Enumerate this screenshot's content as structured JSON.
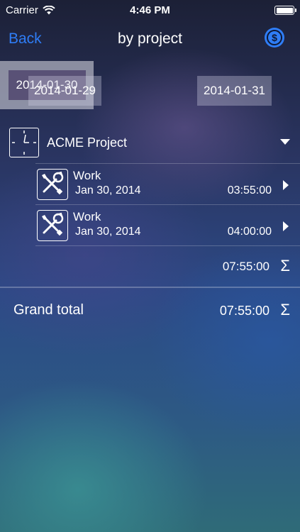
{
  "status_bar": {
    "carrier": "Carrier",
    "time": "4:46 PM",
    "battery_level": 1.0
  },
  "nav": {
    "back_label": "Back",
    "title": "by project",
    "action_icon": "dollar-circle-icon",
    "accent_color": "#2f7df6"
  },
  "dates": {
    "previous": "2014-01-29",
    "selected": "2014-01-30",
    "next": "2014-01-31"
  },
  "project": {
    "name": "ACME Project",
    "icon": "clock-icon",
    "entries": [
      {
        "title": "Work",
        "date": "Jan 30, 2014",
        "duration": "03:55:00",
        "icon": "tools-icon"
      },
      {
        "title": "Work",
        "date": "Jan 30, 2014",
        "duration": "04:00:00",
        "icon": "tools-icon"
      }
    ],
    "total": "07:55:00"
  },
  "grand_total": {
    "label": "Grand total",
    "value": "07:55:00"
  },
  "sum_symbol": "Σ"
}
